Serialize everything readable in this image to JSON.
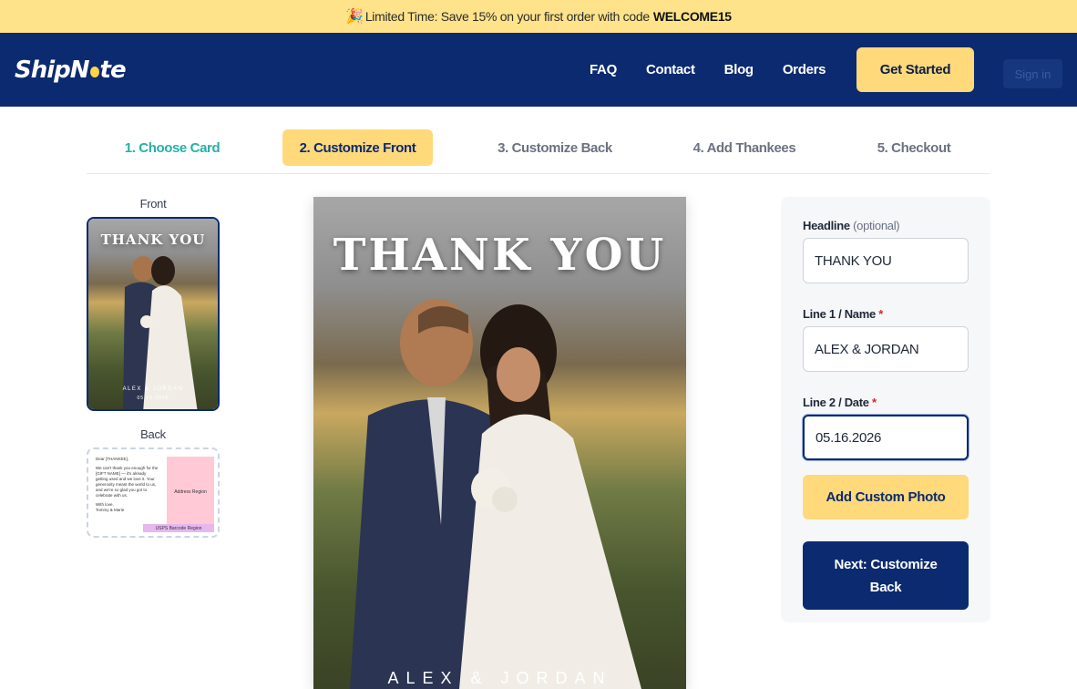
{
  "promo": {
    "text": "Limited Time: Save 15% on your first order with code",
    "code": "WELCOME15",
    "icon": "party-popper-icon"
  },
  "nav": {
    "logo_pre": "ShipN",
    "logo_post": "te",
    "links": [
      "FAQ",
      "Contact",
      "Blog",
      "Orders"
    ],
    "get_started": "Get Started",
    "sign_in": "Sign in"
  },
  "steps": [
    {
      "label": "1. Choose Card",
      "state": "done"
    },
    {
      "label": "2. Customize Front",
      "state": "active"
    },
    {
      "label": "3. Customize Back",
      "state": "pending"
    },
    {
      "label": "4. Add Thankees",
      "state": "pending"
    },
    {
      "label": "5. Checkout",
      "state": "pending"
    }
  ],
  "thumbnails": {
    "front_label": "Front",
    "back_label": "Back",
    "front_title": "THANK YOU",
    "front_names": "ALEX & JORDAN",
    "front_date": "05.16.2026",
    "back_greeting": "Dear [THANKEE],",
    "back_body": "We can't thank you enough for the [GIFT NAME] — it's already getting used and we love it. Your generosity meant the world to us, and we're so glad you got to celebrate with us.",
    "back_signoff": "With love,",
    "back_signature": "Tommy & Marie",
    "back_address": "Address Region",
    "back_barcode": "USPS Barcode Region"
  },
  "preview": {
    "title": "THANK YOU",
    "names": "ALEX & JORDAN"
  },
  "form": {
    "headline_label": "Headline",
    "headline_optional": "(optional)",
    "headline_value": "THANK YOU",
    "line1_label": "Line 1 / Name",
    "line1_value": "ALEX & JORDAN",
    "line2_label": "Line 2 / Date",
    "line2_value": "05.16.2026",
    "required_mark": "*",
    "add_photo": "Add Custom Photo",
    "next": "Next: Customize Back"
  }
}
